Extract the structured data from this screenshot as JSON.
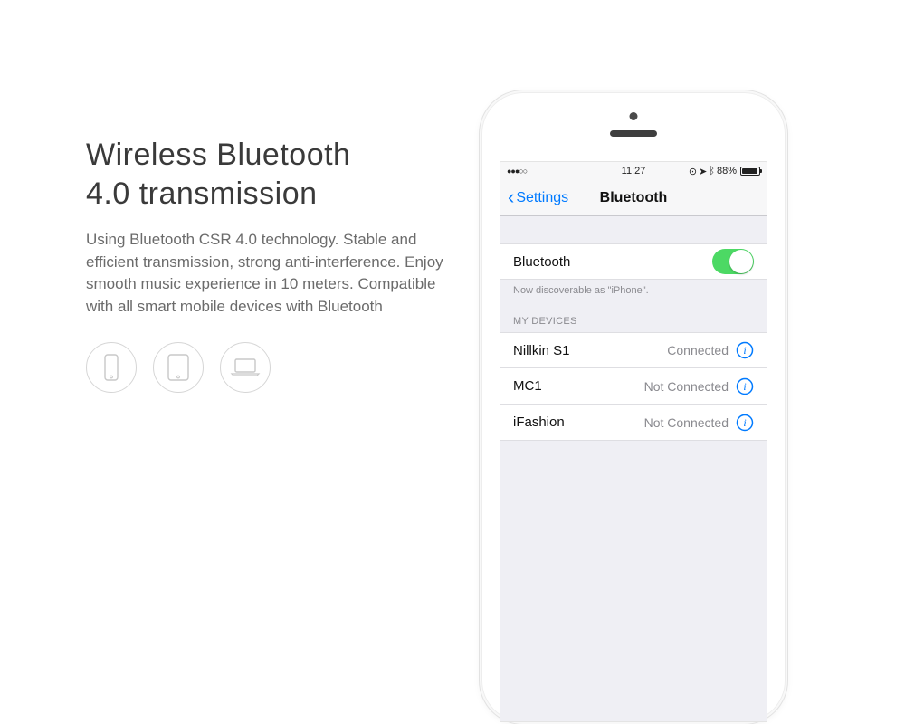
{
  "marketing": {
    "headline_line1": "Wireless Bluetooth",
    "headline_line2": "4.0 transmission",
    "body": "Using Bluetooth CSR 4.0 technology. Stable and efficient transmission, strong anti-interference. Enjoy smooth music experience in 10 meters. Compatible with all smart mobile devices with Bluetooth"
  },
  "statusbar": {
    "carrier_dots": "●●●○○",
    "time": "11:27",
    "battery_pct": "88%"
  },
  "navbar": {
    "back_label": "Settings",
    "title": "Bluetooth"
  },
  "bluetooth_row": {
    "label": "Bluetooth",
    "on": true
  },
  "discoverable_text": "Now discoverable as \"iPhone\".",
  "devices_header": "MY DEVICES",
  "devices": [
    {
      "name": "Nillkin S1",
      "status": "Connected"
    },
    {
      "name": "MC1",
      "status": "Not Connected"
    },
    {
      "name": "iFashion",
      "status": "Not Connected"
    }
  ]
}
